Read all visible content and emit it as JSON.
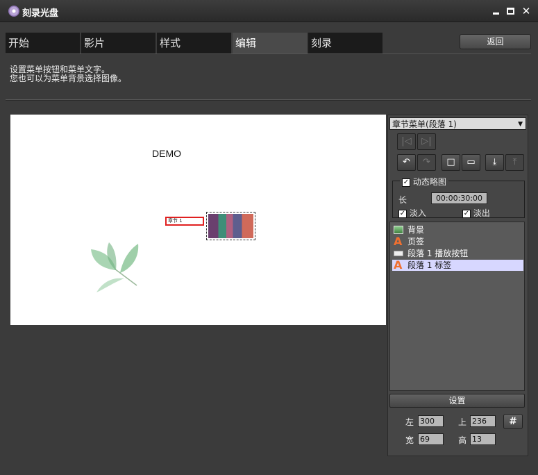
{
  "window": {
    "title": "刻录光盘"
  },
  "tabs": [
    {
      "label": "开始"
    },
    {
      "label": "影片"
    },
    {
      "label": "样式"
    },
    {
      "label": "编辑",
      "active": true
    },
    {
      "label": "刻录"
    }
  ],
  "back_label": "返回",
  "instructions": {
    "line1": "设置菜单按钮和菜单文字。",
    "line2": "您也可以为菜单背景选择图像。"
  },
  "preview": {
    "title": "DEMO",
    "chapter_label": "章节 1"
  },
  "panel": {
    "menu_selected": "章节菜单(段落 1)",
    "toolbar": [
      {
        "icon": "first-frame-icon",
        "glyph": "|◁",
        "enabled": false
      },
      {
        "icon": "last-frame-icon",
        "glyph": "▷|",
        "enabled": false
      },
      {
        "icon": "undo-icon",
        "glyph": "↶",
        "enabled": true
      },
      {
        "icon": "redo-icon",
        "glyph": "↷",
        "enabled": false
      },
      {
        "icon": "square-icon",
        "glyph": "□",
        "enabled": true
      },
      {
        "icon": "monitor-icon",
        "glyph": "▭",
        "enabled": true
      },
      {
        "icon": "import-icon",
        "glyph": "⤓",
        "enabled": true
      },
      {
        "icon": "export-icon",
        "glyph": "⤒",
        "enabled": false
      }
    ],
    "motion_thumb": {
      "label": "动态略图",
      "checked": true
    },
    "length": {
      "label": "长",
      "value": "00:00:30:00"
    },
    "fade_in": {
      "label": "淡入",
      "checked": true
    },
    "fade_out": {
      "label": "淡出",
      "checked": true
    },
    "layers": [
      {
        "label": "背景",
        "icon": "background-icon"
      },
      {
        "label": "页签",
        "icon": "text-icon"
      },
      {
        "label": "段落 1 播放按钮",
        "icon": "button-icon"
      },
      {
        "label": "段落 1 标签",
        "icon": "text-icon",
        "selected": true
      }
    ],
    "settings_label": "设置",
    "fields": {
      "left": {
        "label": "左",
        "value": "300"
      },
      "top": {
        "label": "上",
        "value": "236"
      },
      "width": {
        "label": "宽",
        "value": "69"
      },
      "height": {
        "label": "高",
        "value": "13"
      }
    }
  },
  "colors": {
    "accent": "#e02020",
    "selected_row": "#d7d7ff",
    "window_bg": "#3b3b3b"
  }
}
